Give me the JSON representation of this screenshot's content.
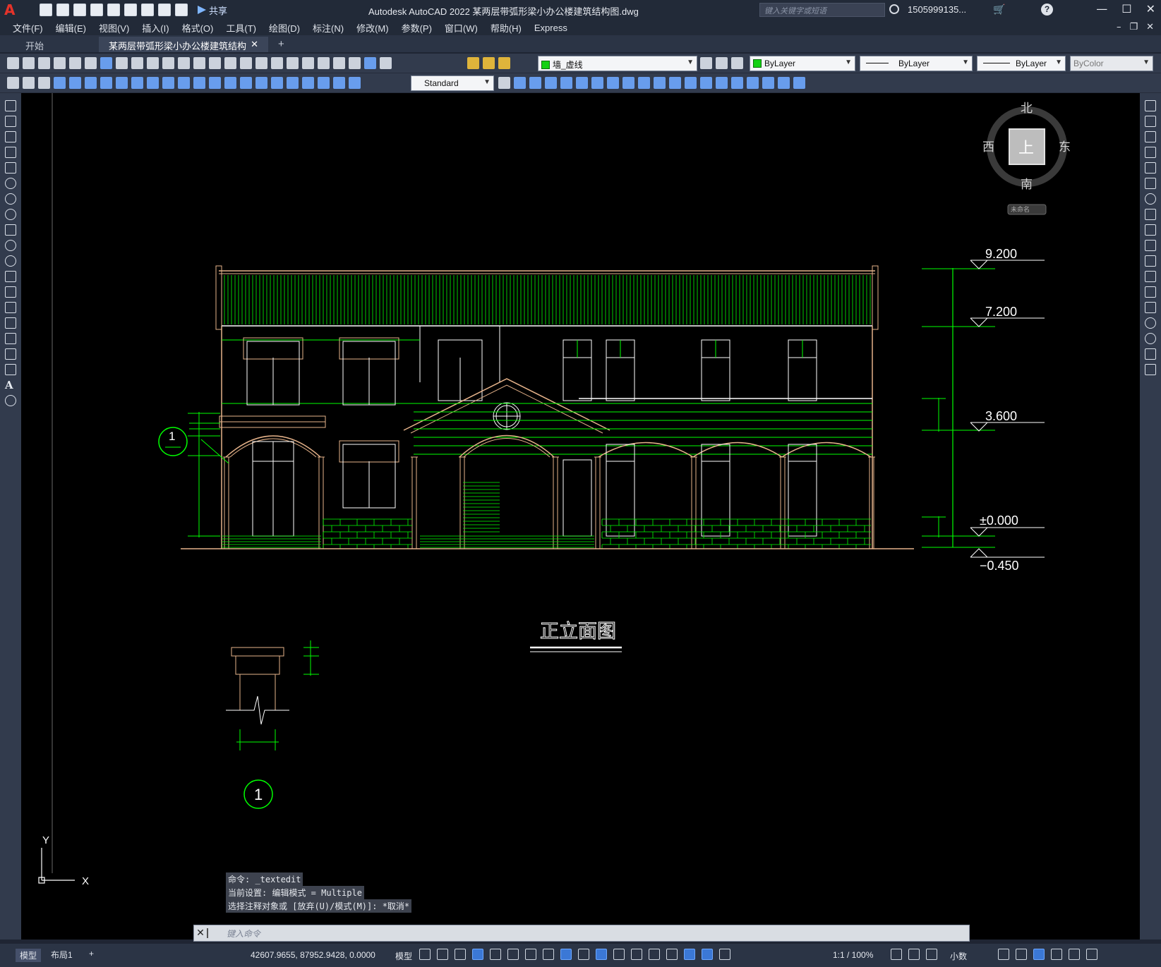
{
  "app": {
    "logo": "A",
    "title": "Autodesk AutoCAD 2022    某两层带弧形梁小办公楼建筑结构图.dwg",
    "share_label": "共享",
    "search_placeholder": "键入关键字或短语",
    "user": "1505999135...",
    "help": "?",
    "win_controls": [
      "—",
      "☐",
      "✕"
    ]
  },
  "menu": [
    "文件(F)",
    "编辑(E)",
    "视图(V)",
    "插入(I)",
    "格式(O)",
    "工具(T)",
    "绘图(D)",
    "标注(N)",
    "修改(M)",
    "参数(P)",
    "窗口(W)",
    "帮助(H)",
    "Express"
  ],
  "tabs": {
    "start": "开始",
    "active": "某两层带弧形梁小办公楼建筑结构图*",
    "close": "✕",
    "add": "+"
  },
  "toolbar": {
    "layer": "墙_虚线",
    "color": "ByLayer",
    "linetype": "ByLayer",
    "lineweight": "ByLayer",
    "plotstyle": "ByColor",
    "textstyle": "Standard"
  },
  "viewcube": {
    "north": "北",
    "south": "南",
    "east": "东",
    "west": "西",
    "face": "上",
    "wcs": "未命名"
  },
  "drawing": {
    "elevations": [
      "9.200",
      "7.200",
      "3.600",
      "±0.000",
      "−0.450"
    ],
    "title": "正立面图",
    "section_mark": "1",
    "detail_mark": "1",
    "axis_x": "X",
    "axis_y": "Y"
  },
  "command": {
    "history": [
      "命令: _textedit",
      "当前设置: 编辑模式 = Multiple",
      "选择注释对象或 [放弃(U)/模式(M)]: *取消*"
    ],
    "placeholder": "键入命令"
  },
  "status": {
    "model_tab": "模型",
    "layout_tab": "布局1",
    "add_tab": "+",
    "coords": "42607.9655, 87952.9428, 0.0000",
    "space": "模型",
    "scale": "1:1 / 100%",
    "units": "小数"
  },
  "colors": {
    "canvas": "#000000",
    "green": "#00ff00",
    "wall": "#e6b38a",
    "white": "#ffffff"
  }
}
